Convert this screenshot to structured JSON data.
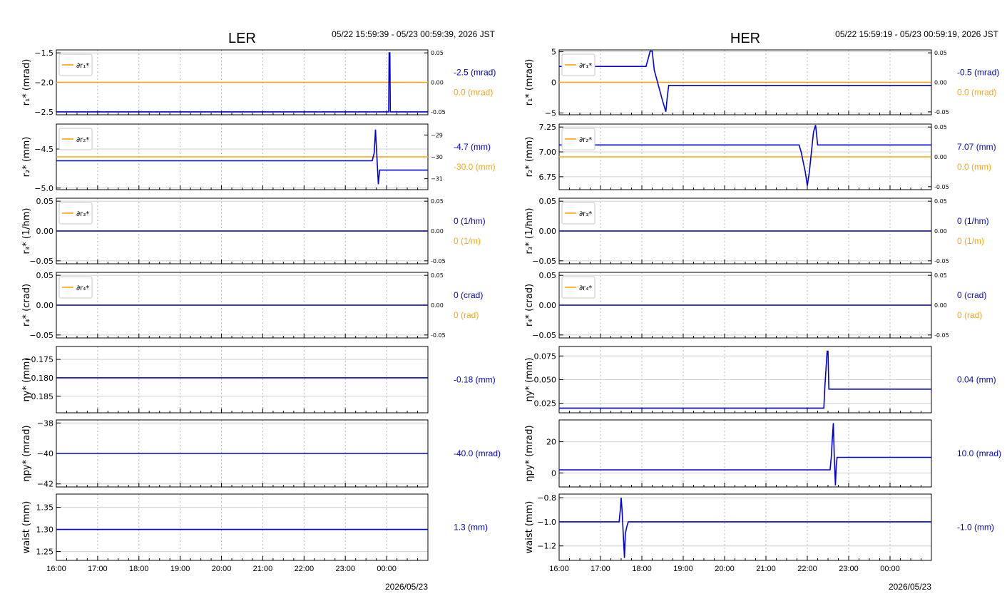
{
  "colors": {
    "primary": "#0000dd",
    "secondary": "#ffa500",
    "axis": "#000000",
    "grid": "#b8b8b8"
  },
  "x_ticks": [
    "16:00",
    "17:00",
    "18:00",
    "19:00",
    "20:00",
    "21:00",
    "22:00",
    "23:00",
    "00:00"
  ],
  "chart_data": [
    {
      "type": "line",
      "title": "LER",
      "time_range": "05/22 15:59:39 - 05/23 00:59:39, 2026 JST",
      "date_label": "2026/05/23",
      "x_unit": "hours since 16:00",
      "xlim": [
        0,
        9
      ],
      "panels": [
        {
          "ylabel": "r₁* (mrad)",
          "ylim": [
            -2.55,
            -1.45
          ],
          "yticks": [
            -2.5,
            -2.0,
            -1.5
          ],
          "ytick_labels": [
            "−2.5",
            "−2.0",
            "−1.5"
          ],
          "y2lim": [
            -0.055,
            0.055
          ],
          "y2ticks": [
            -0.05,
            0,
            0.05
          ],
          "y2tick_labels": [
            "-0.05",
            "0.00",
            "0.05"
          ],
          "legend": "∂r₁*",
          "current_value": "-2.5 (mrad)",
          "current_value2": "0.0 (mrad)",
          "series": [
            {
              "name": "r₁*",
              "axis": "left",
              "x": [
                0,
                8.05,
                8.06,
                8.08,
                8.09,
                8.1,
                9
              ],
              "y": [
                -2.5,
                -2.5,
                -1.5,
                -1.5,
                -2.5,
                -2.5,
                -2.5
              ]
            },
            {
              "name": "∂r₁*",
              "axis": "right",
              "x": [
                0,
                9
              ],
              "y": [
                0,
                0
              ]
            }
          ]
        },
        {
          "ylabel": "r₂* (mm)",
          "ylim": [
            -5.02,
            -4.18
          ],
          "yticks": [
            -5.0,
            -4.5
          ],
          "ytick_labels": [
            "−5.0",
            "−4.5"
          ],
          "y2lim": [
            -31.5,
            -28.5
          ],
          "y2ticks": [
            -31,
            -30,
            -29
          ],
          "y2tick_labels": [
            "−31",
            "−30",
            "−29"
          ],
          "legend": "∂r₂*",
          "current_value": "-4.7 (mm)",
          "current_value2": "-30.0 (mm)",
          "series": [
            {
              "name": "r₂*",
              "axis": "left",
              "x": [
                0,
                7.65,
                7.7,
                7.73,
                7.76,
                7.8,
                7.83,
                7.86,
                9
              ],
              "y": [
                -4.65,
                -4.65,
                -4.55,
                -4.25,
                -4.55,
                -4.95,
                -4.77,
                -4.77,
                -4.77
              ]
            },
            {
              "name": "∂r₂*",
              "axis": "right",
              "x": [
                0,
                9
              ],
              "y": [
                -30,
                -30
              ]
            }
          ]
        },
        {
          "ylabel": "r₃* (1/hm)",
          "ylim": [
            -0.055,
            0.055
          ],
          "yticks": [
            -0.05,
            0,
            0.05
          ],
          "ytick_labels": [
            "−0.05",
            "0.00",
            "0.05"
          ],
          "y2lim": [
            -0.055,
            0.055
          ],
          "y2ticks": [
            -0.05,
            0,
            0.05
          ],
          "y2tick_labels": [
            "-0.05",
            "0.00",
            "0.05"
          ],
          "legend": "∂r₃*",
          "current_value": "0 (1/hm)",
          "current_value2": "0 (1/m)",
          "series": [
            {
              "name": "r₃*",
              "axis": "left",
              "x": [
                0,
                9
              ],
              "y": [
                0,
                0
              ]
            },
            {
              "name": "∂r₃*",
              "axis": "right",
              "x": [
                0,
                9
              ],
              "y": [
                0,
                0
              ]
            }
          ]
        },
        {
          "ylabel": "r₄* (crad)",
          "ylim": [
            -0.055,
            0.055
          ],
          "yticks": [
            -0.05,
            0,
            0.05
          ],
          "ytick_labels": [
            "−0.05",
            "0.00",
            "0.05"
          ],
          "y2lim": [
            -0.055,
            0.055
          ],
          "y2ticks": [
            -0.05,
            0,
            0.05
          ],
          "y2tick_labels": [
            "-0.05",
            "0.00",
            "0.05"
          ],
          "legend": "∂r₄*",
          "current_value": "0 (crad)",
          "current_value2": "0 (rad)",
          "series": [
            {
              "name": "r₄*",
              "axis": "left",
              "x": [
                0,
                9
              ],
              "y": [
                0,
                0
              ]
            },
            {
              "name": "∂r₄*",
              "axis": "right",
              "x": [
                0,
                9
              ],
              "y": [
                0,
                0
              ]
            }
          ]
        },
        {
          "ylabel": "ηy* (mm)",
          "ylim": [
            -0.1895,
            -0.1715
          ],
          "yticks": [
            -0.185,
            -0.18,
            -0.175
          ],
          "ytick_labels": [
            "−0.185",
            "−0.180",
            "−0.175"
          ],
          "current_value": "-0.18 (mm)",
          "series": [
            {
              "name": "ηy*",
              "axis": "left",
              "x": [
                0,
                9
              ],
              "y": [
                -0.18,
                -0.18
              ]
            }
          ]
        },
        {
          "ylabel": "ηpy* (mrad)",
          "ylim": [
            -42.2,
            -37.8
          ],
          "yticks": [
            -42,
            -40,
            -38
          ],
          "ytick_labels": [
            "−42",
            "−40",
            "−38"
          ],
          "current_value": "-40.0 (mrad)",
          "series": [
            {
              "name": "ηpy*",
              "axis": "left",
              "x": [
                0,
                9
              ],
              "y": [
                -40,
                -40
              ]
            }
          ]
        },
        {
          "ylabel": "waist (mm)",
          "ylim": [
            1.23,
            1.38
          ],
          "yticks": [
            1.25,
            1.3,
            1.35
          ],
          "ytick_labels": [
            "1.25",
            "1.30",
            "1.35"
          ],
          "current_value": "1.3 (mm)",
          "series": [
            {
              "name": "waist",
              "axis": "left",
              "x": [
                0,
                9
              ],
              "y": [
                1.3,
                1.3
              ]
            }
          ]
        }
      ]
    },
    {
      "type": "line",
      "title": "HER",
      "time_range": "05/22 15:59:19 - 05/23 00:59:19, 2026 JST",
      "date_label": "2026/05/23",
      "x_unit": "hours since 16:00",
      "xlim": [
        0,
        9
      ],
      "panels": [
        {
          "ylabel": "r₁* (mrad)",
          "ylim": [
            -5.3,
            5.3
          ],
          "yticks": [
            -5,
            0,
            5
          ],
          "ytick_labels": [
            "−5",
            "0",
            "5"
          ],
          "y2lim": [
            -0.055,
            0.055
          ],
          "y2ticks": [
            -0.05,
            0,
            0.05
          ],
          "y2tick_labels": [
            "-0.05",
            "0.00",
            "0.05"
          ],
          "legend": "∂r₁*",
          "current_value": "-0.5 (mrad)",
          "current_value2": "0.0 (mrad)",
          "series": [
            {
              "name": "r₁*",
              "axis": "left",
              "x": [
                0,
                2.1,
                2.15,
                2.2,
                2.25,
                2.3,
                2.4,
                2.5,
                2.58,
                2.62,
                2.65,
                9
              ],
              "y": [
                2.6,
                2.6,
                3.8,
                5.1,
                5.1,
                2.0,
                -0.5,
                -3.0,
                -4.8,
                -2.0,
                -0.5,
                -0.5
              ]
            },
            {
              "name": "∂r₁*",
              "axis": "right",
              "x": [
                0,
                9
              ],
              "y": [
                0,
                0
              ]
            }
          ]
        },
        {
          "ylabel": "r₂* (mm)",
          "ylim": [
            6.62,
            7.28
          ],
          "yticks": [
            6.75,
            7.0,
            7.25
          ],
          "ytick_labels": [
            "6.75",
            "7.00",
            "7.25"
          ],
          "y2lim": [
            -0.055,
            0.055
          ],
          "y2ticks": [
            -0.05,
            0,
            0.05
          ],
          "y2tick_labels": [
            "-0.05",
            "0.00",
            "0.05"
          ],
          "legend": "∂r₂*",
          "current_value": "7.07 (mm)",
          "current_value2": "0.0 (mm)",
          "series": [
            {
              "name": "r₂*",
              "axis": "left",
              "x": [
                0,
                5.8,
                5.85,
                5.9,
                5.95,
                6.0,
                6.05,
                6.1,
                6.15,
                6.2,
                6.25,
                9
              ],
              "y": [
                7.07,
                7.07,
                7.0,
                6.9,
                6.8,
                6.66,
                6.8,
                7.0,
                7.2,
                7.27,
                7.07,
                7.07
              ]
            },
            {
              "name": "∂r₂*",
              "axis": "right",
              "x": [
                0,
                9
              ],
              "y": [
                0,
                0
              ]
            }
          ]
        },
        {
          "ylabel": "r₃* (1/hm)",
          "ylim": [
            -0.055,
            0.055
          ],
          "yticks": [
            -0.05,
            0,
            0.05
          ],
          "ytick_labels": [
            "−0.05",
            "0.00",
            "0.05"
          ],
          "y2lim": [
            -0.055,
            0.055
          ],
          "y2ticks": [
            -0.05,
            0,
            0.05
          ],
          "y2tick_labels": [
            "-0.05",
            "0.00",
            "0.05"
          ],
          "legend": "∂r₃*",
          "current_value": "0 (1/hm)",
          "current_value2": "0 (1/m)",
          "series": [
            {
              "name": "r₃*",
              "axis": "left",
              "x": [
                0,
                9
              ],
              "y": [
                0,
                0
              ]
            },
            {
              "name": "∂r₃*",
              "axis": "right",
              "x": [
                0,
                9
              ],
              "y": [
                0,
                0
              ]
            }
          ]
        },
        {
          "ylabel": "r₄* (crad)",
          "ylim": [
            -0.055,
            0.055
          ],
          "yticks": [
            -0.05,
            0,
            0.05
          ],
          "ytick_labels": [
            "−0.05",
            "0.00",
            "0.05"
          ],
          "y2lim": [
            -0.055,
            0.055
          ],
          "y2ticks": [
            -0.05,
            0,
            0.05
          ],
          "y2tick_labels": [
            "-0.05",
            "0.00",
            "0.05"
          ],
          "legend": "∂r₄*",
          "current_value": "0 (crad)",
          "current_value2": "0 (rad)",
          "series": [
            {
              "name": "r₄*",
              "axis": "left",
              "x": [
                0,
                9
              ],
              "y": [
                0,
                0
              ]
            },
            {
              "name": "∂r₄*",
              "axis": "right",
              "x": [
                0,
                9
              ],
              "y": [
                0,
                0
              ]
            }
          ]
        },
        {
          "ylabel": "ηy* (mm)",
          "ylim": [
            0.015,
            0.085
          ],
          "yticks": [
            0.025,
            0.05,
            0.075
          ],
          "ytick_labels": [
            "0.025",
            "0.050",
            "0.075"
          ],
          "current_value": "0.04 (mm)",
          "series": [
            {
              "name": "ηy*",
              "axis": "left",
              "x": [
                0,
                6.4,
                6.42,
                6.45,
                6.48,
                6.5,
                6.52,
                6.55,
                9
              ],
              "y": [
                0.02,
                0.02,
                0.04,
                0.06,
                0.08,
                0.08,
                0.04,
                0.04,
                0.04
              ]
            }
          ]
        },
        {
          "ylabel": "ηpy* (mrad)",
          "ylim": [
            -9,
            34
          ],
          "yticks": [
            0,
            20
          ],
          "ytick_labels": [
            "0",
            "20"
          ],
          "current_value": "10.0 (mrad)",
          "series": [
            {
              "name": "ηpy*",
              "axis": "left",
              "x": [
                0,
                6.55,
                6.58,
                6.6,
                6.63,
                6.65,
                6.68,
                6.7,
                6.72,
                6.75,
                9
              ],
              "y": [
                2,
                2,
                10,
                20,
                32,
                12,
                -8,
                5,
                10,
                10,
                10
              ]
            }
          ]
        },
        {
          "ylabel": "waist (mm)",
          "ylim": [
            -1.32,
            -0.77
          ],
          "yticks": [
            -1.2,
            -1.0,
            -0.8
          ],
          "ytick_labels": [
            "−1.2",
            "−1.0",
            "−0.8"
          ],
          "current_value": "-1.0 (mm)",
          "series": [
            {
              "name": "waist",
              "axis": "left",
              "x": [
                0,
                1.45,
                1.48,
                1.5,
                1.52,
                1.55,
                1.58,
                1.6,
                1.63,
                1.67,
                9
              ],
              "y": [
                -1.0,
                -1.0,
                -0.9,
                -0.8,
                -0.9,
                -1.1,
                -1.3,
                -1.1,
                -1.05,
                -1.0,
                -1.0
              ]
            }
          ]
        }
      ]
    }
  ]
}
